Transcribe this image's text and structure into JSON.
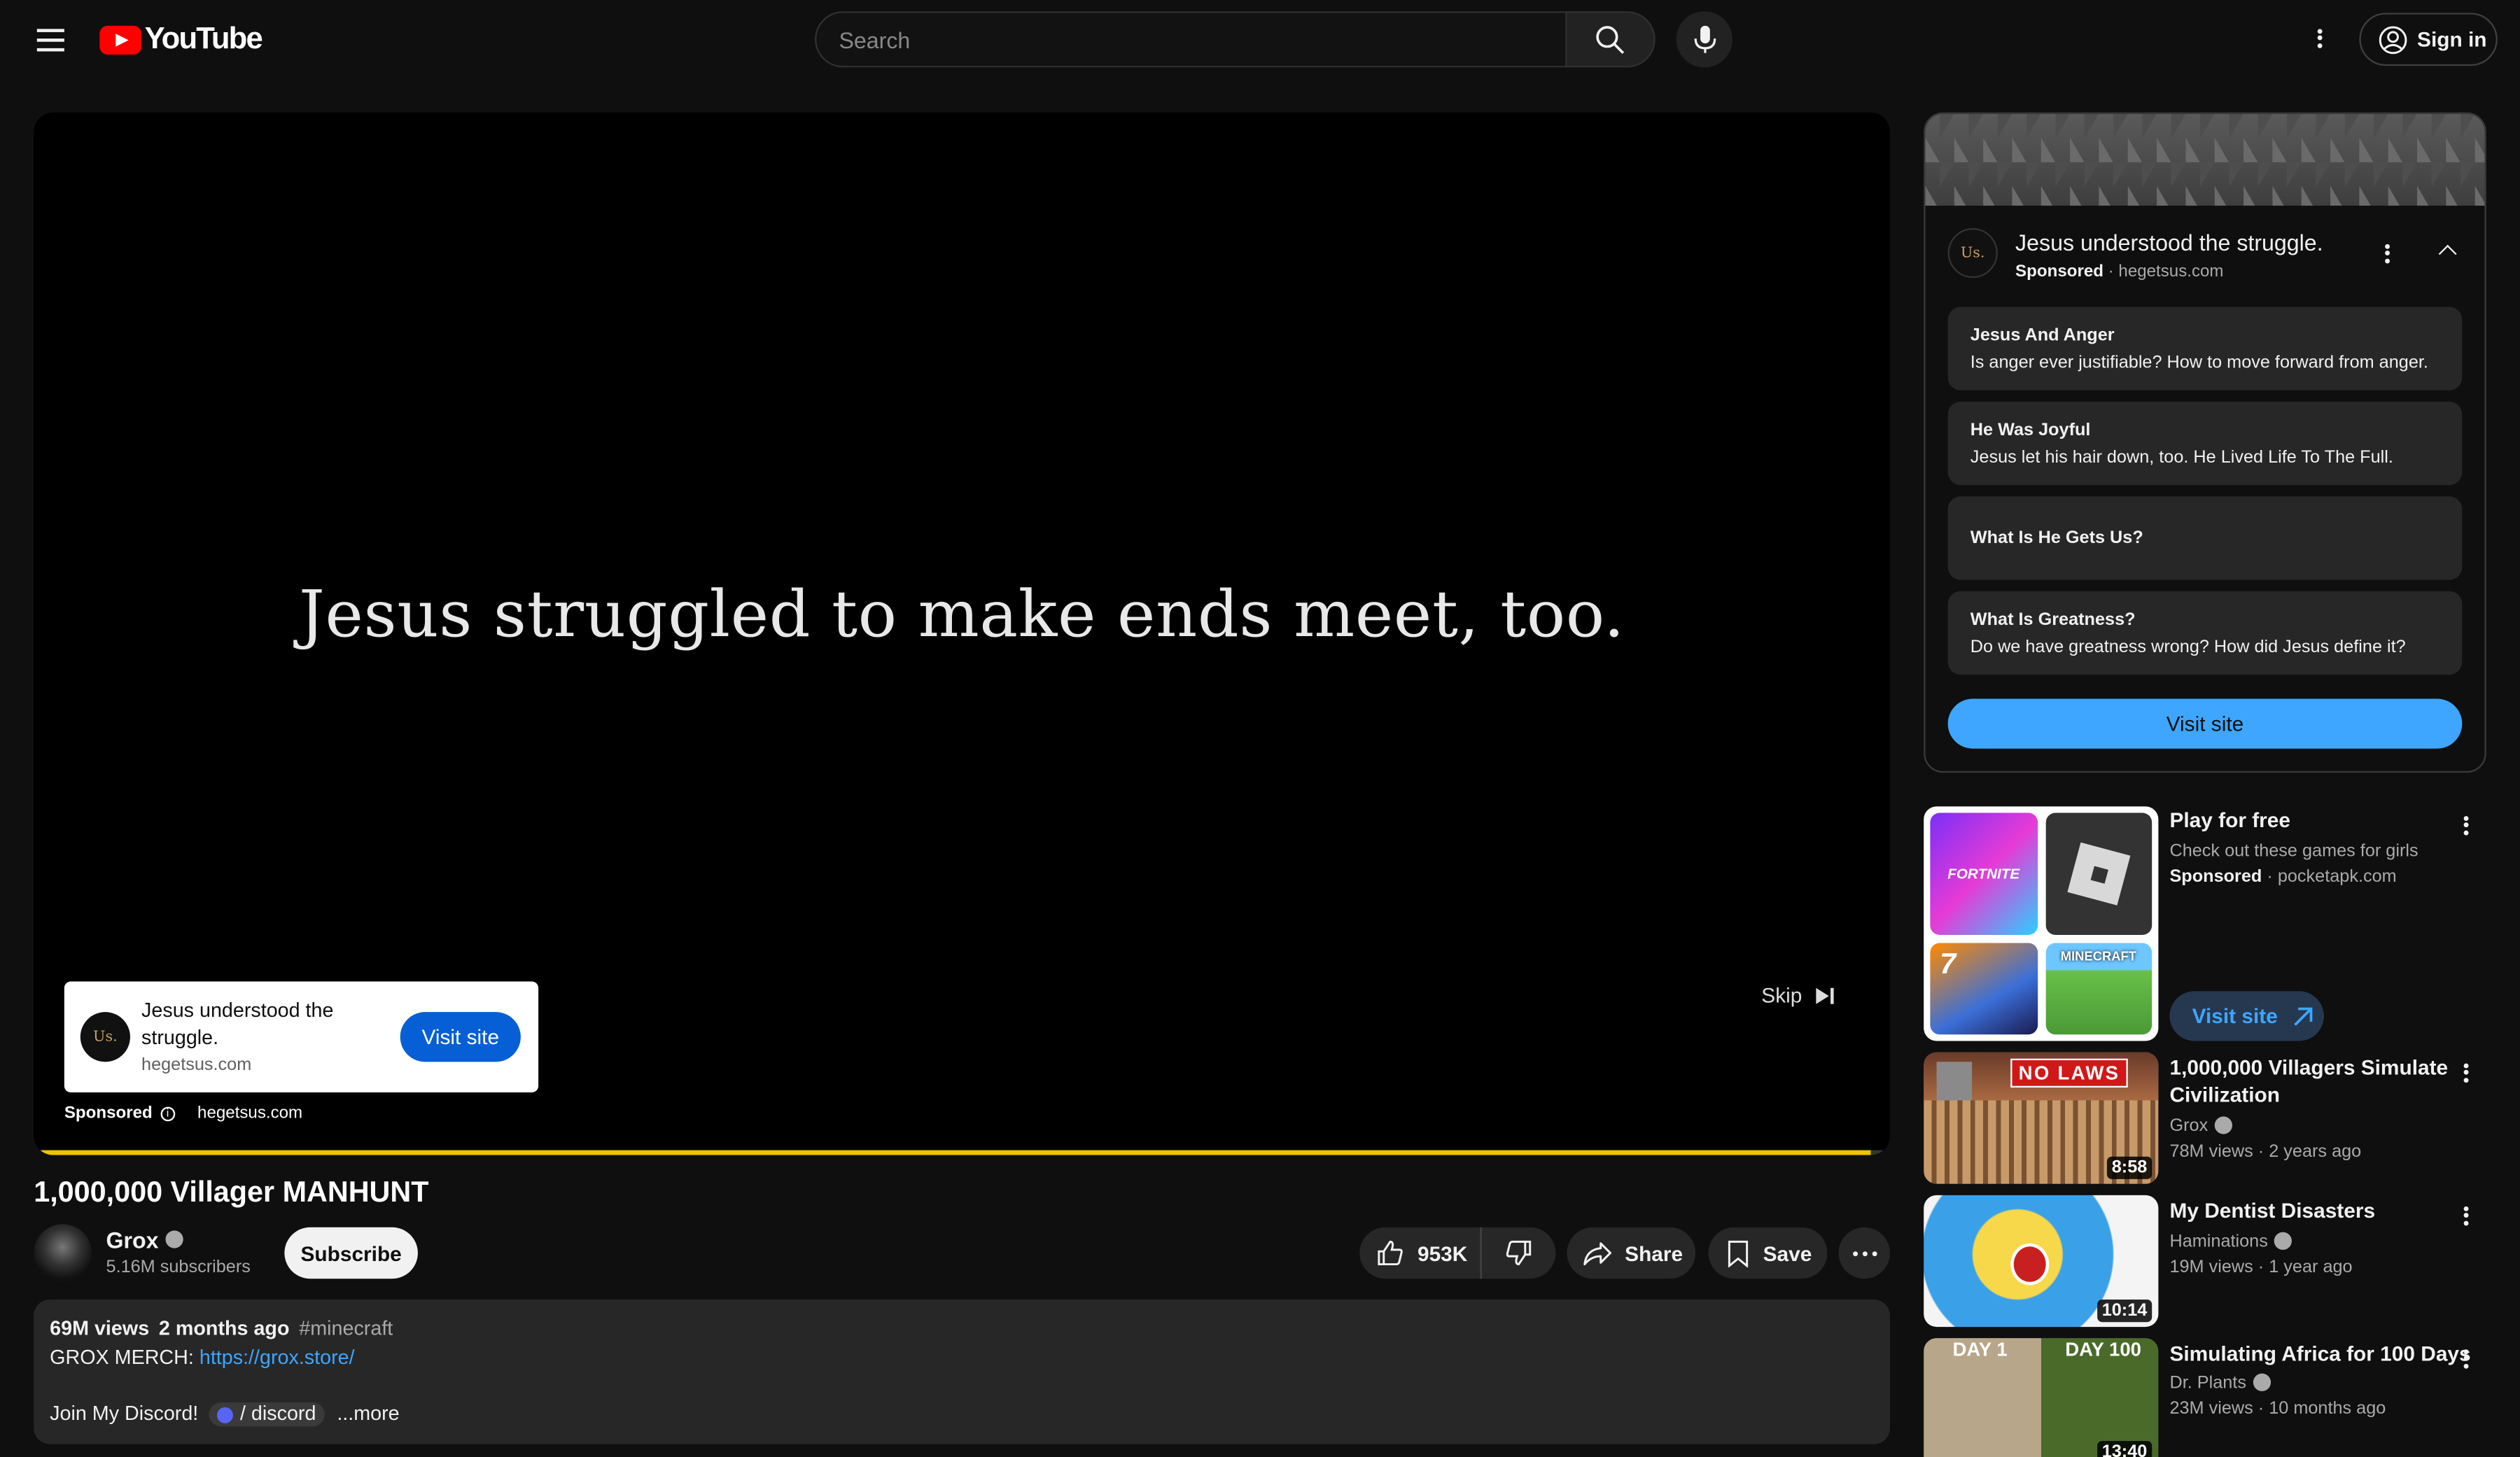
{
  "header": {
    "logo_text": "YouTube",
    "search_placeholder": "Search",
    "sign_in_label": "Sign in"
  },
  "player": {
    "ad_headline": "Jesus struggled to make ends meet, too.",
    "skip_label": "Skip",
    "ad_card": {
      "avatar_text": "Us.",
      "title": "Jesus understood the struggle.",
      "domain": "hegetsus.com",
      "visit_label": "Visit site"
    },
    "sponsored_label": "Sponsored",
    "sponsored_domain": "hegetsus.com",
    "progress": 0.99
  },
  "video": {
    "title": "1,000,000 Villager MANHUNT",
    "channel": "Grox",
    "subscribers": "5.16M subscribers",
    "subscribe_label": "Subscribe",
    "likes": "953K",
    "share_label": "Share",
    "save_label": "Save"
  },
  "description": {
    "views": "69M views",
    "date": "2 months ago",
    "hashtag": "#minecraft",
    "merch_prefix": "GROX MERCH:",
    "merch_link": "https://grox.store/",
    "discord_prefix": "Join My Discord!",
    "discord_link": "/ discord",
    "more_label": "...more"
  },
  "companion_ad": {
    "avatar_text": "Us.",
    "title": "Jesus understood the struggle.",
    "sponsored": "Sponsored",
    "domain": "hegetsus.com",
    "items": [
      {
        "title": "Jesus And Anger",
        "desc": "Is anger ever justifiable? How to move forward from anger."
      },
      {
        "title": "He Was Joyful",
        "desc": "Jesus let his hair down, too. He Lived Life To The Full."
      },
      {
        "title": "What Is He Gets Us?",
        "desc": ""
      },
      {
        "title": "What Is Greatness?",
        "desc": "Do we have greatness wrong? How did Jesus define it?"
      }
    ],
    "visit_label": "Visit site"
  },
  "promo_ad": {
    "title": "Play for free",
    "desc": "Check out these games for girls",
    "sponsored": "Sponsored",
    "domain": "pocketapk.com",
    "visit_label": "Visit site",
    "tile_labels": [
      "FORTNITE",
      "MINECRAFT"
    ]
  },
  "related": [
    {
      "title_line1": "1,000,000 Villagers Simulate",
      "title_line2": "Civilization",
      "channel": "Grox",
      "views": "78M views",
      "age": "2 years ago",
      "duration": "8:58",
      "thumb_text": "NO LAWS"
    },
    {
      "title_line1": "My Dentist Disasters",
      "title_line2": "",
      "channel": "Haminations",
      "views": "19M views",
      "age": "1 year ago",
      "duration": "10:14"
    },
    {
      "title_line1": "Simulating Africa for 100 Days",
      "title_line2": "",
      "channel": "Dr. Plants",
      "views": "23M views",
      "age": "10 months ago",
      "duration": "13:40",
      "thumb_left": "DAY 1",
      "thumb_right": "DAY 100"
    }
  ],
  "colors": {
    "youtube_red": "#ff0000",
    "progress_yellow": "#f2c200",
    "ad_blue": "#065fd4",
    "visit_blue": "#3ea6ff",
    "link_blue": "#3ea6ff"
  }
}
